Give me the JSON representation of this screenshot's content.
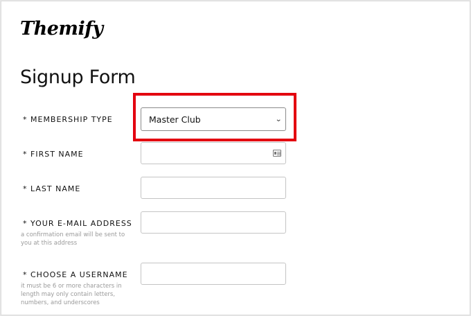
{
  "brand": {
    "logo_text": "Themify"
  },
  "form": {
    "title": "Signup Form",
    "membership": {
      "label": "* MEMBERSHIP TYPE",
      "selected": "Master Club",
      "highlight_color": "#e3000f"
    },
    "first_name": {
      "label": "* FIRST NAME",
      "value": "",
      "autofill_icon": "contact-card-icon"
    },
    "last_name": {
      "label": "* LAST NAME",
      "value": ""
    },
    "email": {
      "label": "* YOUR E-MAIL ADDRESS",
      "hint": "a confirmation email will be sent to you at this address",
      "value": ""
    },
    "username": {
      "label": "* CHOOSE A USERNAME",
      "hint": "it must be 6 or more characters in length may only contain letters, numbers, and underscores",
      "value": ""
    }
  }
}
